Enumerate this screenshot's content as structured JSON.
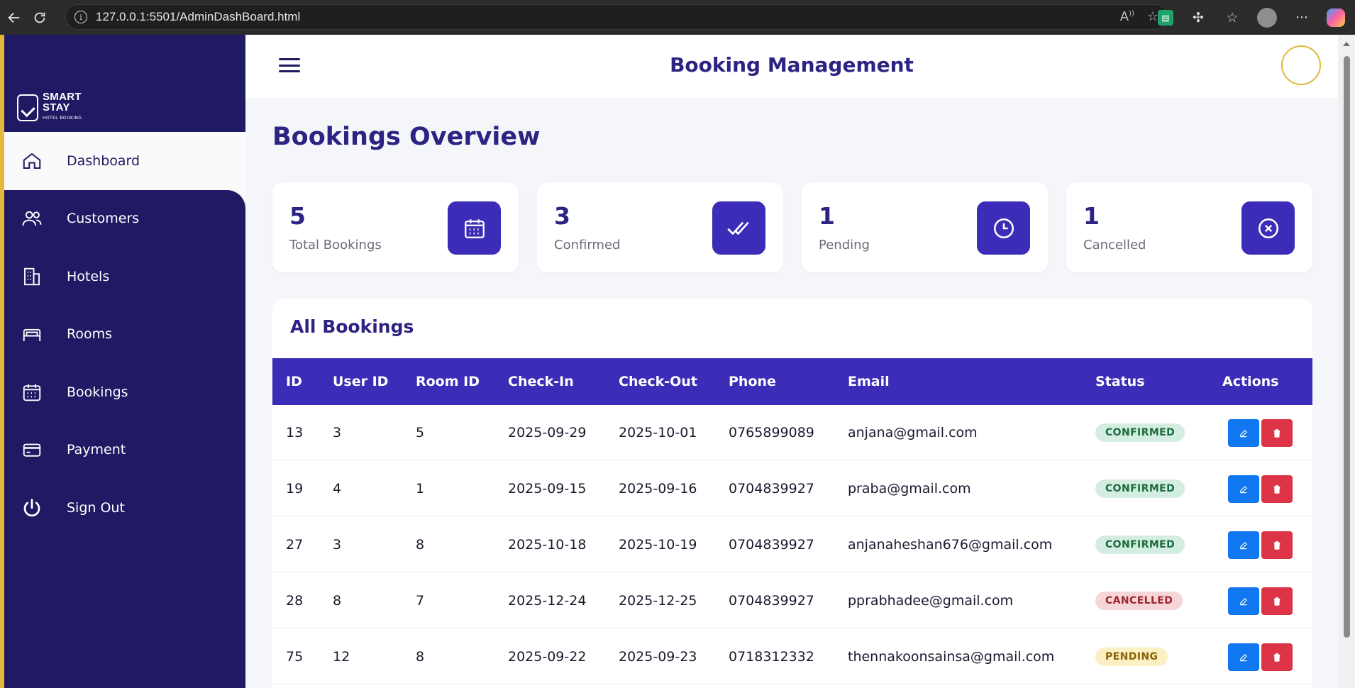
{
  "browser": {
    "url": "127.0.0.1:5501/AdminDashBoard.html"
  },
  "logo": {
    "line1": "SMART",
    "line2": "STAY",
    "line3": "HOTEL BOOKING"
  },
  "sidebar": {
    "items": [
      {
        "label": "Dashboard",
        "icon": "home-icon"
      },
      {
        "label": "Customers",
        "icon": "users-icon"
      },
      {
        "label": "Hotels",
        "icon": "building-icon"
      },
      {
        "label": "Rooms",
        "icon": "bed-icon"
      },
      {
        "label": "Bookings",
        "icon": "calendar-icon"
      },
      {
        "label": "Payment",
        "icon": "credit-card-icon"
      },
      {
        "label": "Sign Out",
        "icon": "power-icon"
      }
    ]
  },
  "header": {
    "title": "Booking Management"
  },
  "page": {
    "title": "Bookings Overview"
  },
  "stats": [
    {
      "value": "5",
      "label": "Total Bookings",
      "icon": "calendar-icon"
    },
    {
      "value": "3",
      "label": "Confirmed",
      "icon": "double-check-icon"
    },
    {
      "value": "1",
      "label": "Pending",
      "icon": "clock-icon"
    },
    {
      "value": "1",
      "label": "Cancelled",
      "icon": "x-circle-icon"
    }
  ],
  "table": {
    "title": "All Bookings",
    "columns": [
      "ID",
      "User ID",
      "Room ID",
      "Check-In",
      "Check-Out",
      "Phone",
      "Email",
      "Status",
      "Actions"
    ],
    "rows": [
      {
        "id": "13",
        "user_id": "3",
        "room_id": "5",
        "check_in": "2025-09-29",
        "check_out": "2025-10-01",
        "phone": "0765899089",
        "email": "anjana@gmail.com",
        "status": "CONFIRMED"
      },
      {
        "id": "19",
        "user_id": "4",
        "room_id": "1",
        "check_in": "2025-09-15",
        "check_out": "2025-09-16",
        "phone": "0704839927",
        "email": "praba@gmail.com",
        "status": "CONFIRMED"
      },
      {
        "id": "27",
        "user_id": "3",
        "room_id": "8",
        "check_in": "2025-10-18",
        "check_out": "2025-10-19",
        "phone": "0704839927",
        "email": "anjanaheshan676@gmail.com",
        "status": "CONFIRMED"
      },
      {
        "id": "28",
        "user_id": "8",
        "room_id": "7",
        "check_in": "2025-12-24",
        "check_out": "2025-12-25",
        "phone": "0704839927",
        "email": "pprabhadee@gmail.com",
        "status": "CANCELLED"
      },
      {
        "id": "75",
        "user_id": "12",
        "room_id": "8",
        "check_in": "2025-09-22",
        "check_out": "2025-09-23",
        "phone": "0718312332",
        "email": "thennakoonsainsa@gmail.com",
        "status": "PENDING"
      }
    ]
  },
  "colors": {
    "sidebar": "#1f1a63",
    "accent": "#3b2db8",
    "gold": "#e2b73c",
    "edit": "#1177f0",
    "delete": "#dc3446"
  }
}
